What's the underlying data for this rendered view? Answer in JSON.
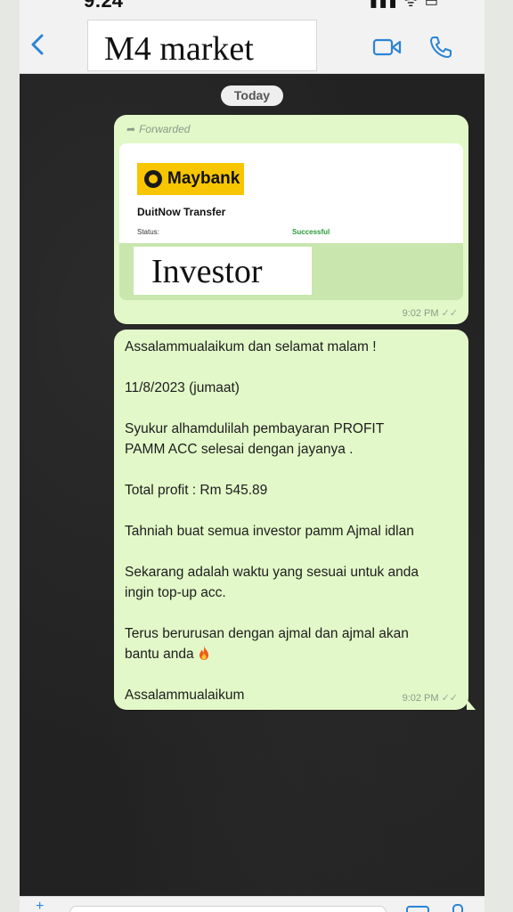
{
  "status_bar": {
    "time": "9:24",
    "icons": "▮▮▮ ᯤ ▭"
  },
  "header": {
    "title": "M4 market",
    "back_icon": "chevron-left-icon",
    "video_icon": "video-camera-icon",
    "call_icon": "phone-icon",
    "accent_color": "#2b84d6"
  },
  "chat": {
    "date_chip": "Today",
    "messages": [
      {
        "forwarded_label": "Forwarded",
        "receipt": {
          "bank": "Maybank",
          "title": "DuitNow Transfer",
          "status_label": "Status:",
          "status_value": "Successful"
        },
        "overlay_label": "Investor",
        "time": "9:02 PM",
        "ticks": "✓✓"
      },
      {
        "paragraphs": [
          "Assalammualaikum dan selamat malam !",
          "11/8/2023 (jumaat)",
          "Syukur alhamdulilah pembayaran PROFIT\nPAMM ACC selesai dengan jayanya .",
          "Total profit : Rm 545.89",
          "Tahniah buat semua investor pamm Ajmal idlan",
          "Sekarang adalah waktu yang sesuai untuk anda\ningin top-up acc.",
          "Terus berurusan dengan ajmal dan ajmal akan\nbantu anda",
          "Assalammualaikum"
        ],
        "emoji": "fire-icon",
        "time": "9:02 PM",
        "ticks": "✓✓"
      }
    ],
    "bubble_color": "#e2f8c8"
  }
}
